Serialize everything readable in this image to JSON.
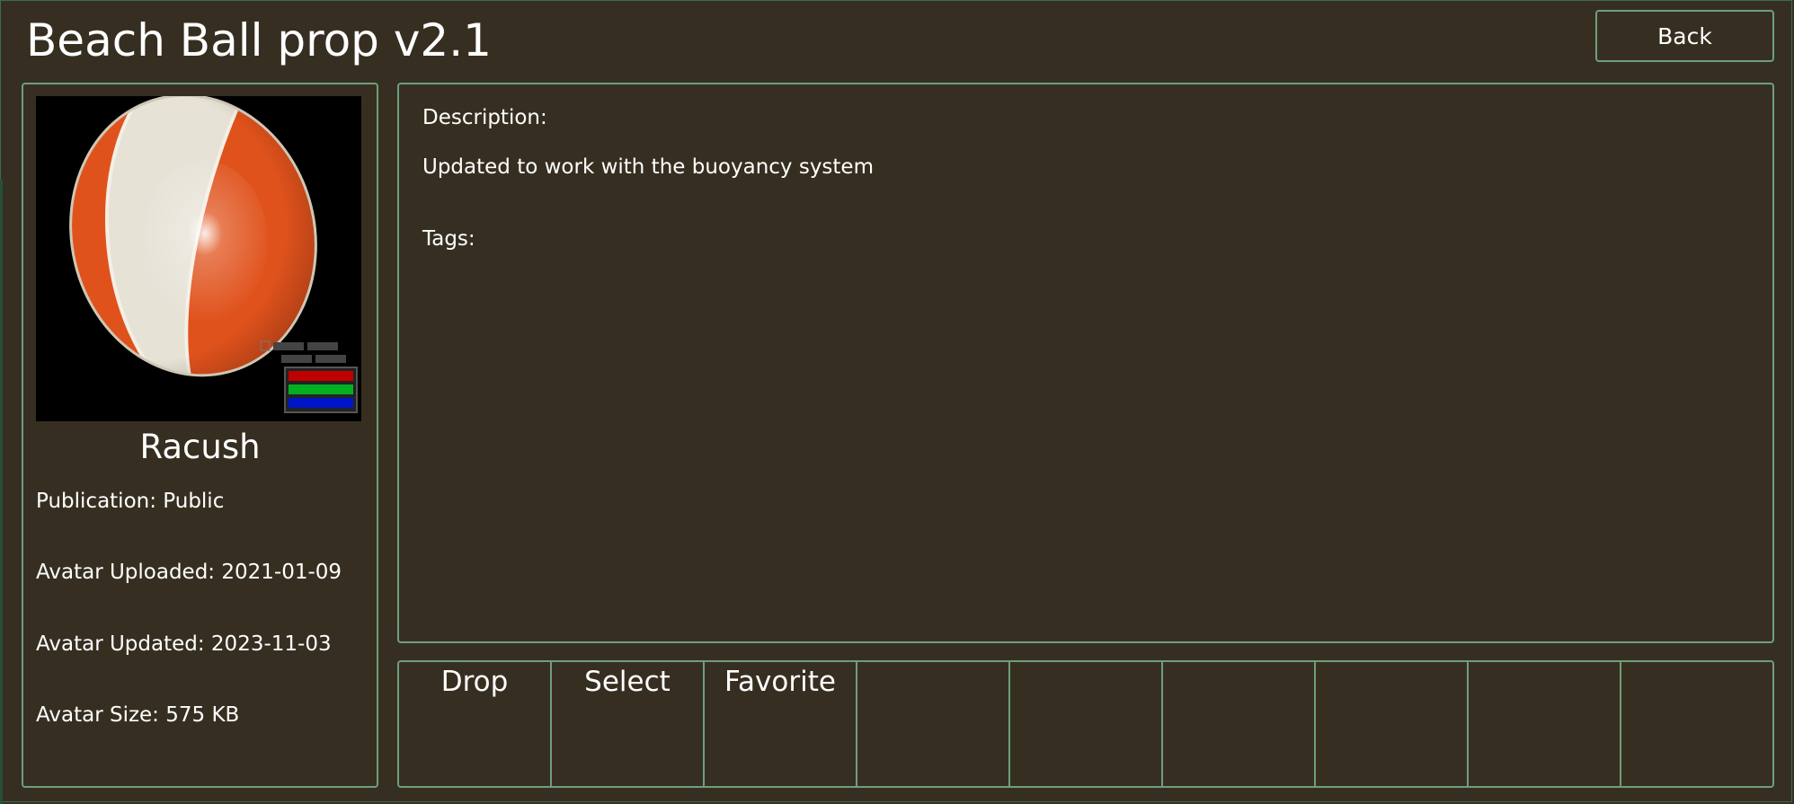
{
  "header": {
    "title": "Beach Ball prop v2.1",
    "back_label": "Back"
  },
  "details": {
    "creator": "Racush",
    "publication": "Publication: Public",
    "uploaded": "Avatar Uploaded: 2021-01-09",
    "updated": "Avatar Updated: 2023-11-03",
    "size": "Avatar Size: 575 KB",
    "thumbnail_icon": "beach-ball-preview"
  },
  "description": {
    "heading": "Description:",
    "text": "Updated to work with the buoyancy system",
    "tags_label": "Tags:"
  },
  "actions": [
    "Drop",
    "Select",
    "Favorite",
    "",
    "",
    "",
    "",
    "",
    ""
  ],
  "colors": {
    "background": "#362f21",
    "border": "#6e9e7d",
    "ball_orange": "#e0521c",
    "ball_white": "#e6e2d6"
  }
}
